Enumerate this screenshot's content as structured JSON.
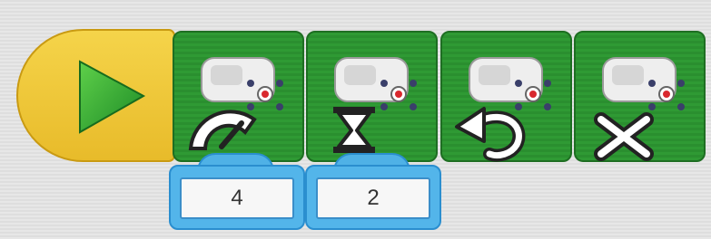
{
  "program": {
    "start_block": {
      "icon": "play-icon",
      "color": "#f0c93a"
    },
    "blocks": [
      {
        "name": "motor-power",
        "icon": "speed-gauge-icon",
        "color": "#2f9a34"
      },
      {
        "name": "motor-on-for",
        "icon": "hourglass-icon",
        "color": "#2f9a34"
      },
      {
        "name": "motor-direction",
        "icon": "reverse-arrow-icon",
        "color": "#2f9a34"
      },
      {
        "name": "motor-off",
        "icon": "stop-x-icon",
        "color": "#2f9a34"
      }
    ],
    "inputs": [
      {
        "value": "4"
      },
      {
        "value": "2"
      }
    ]
  }
}
